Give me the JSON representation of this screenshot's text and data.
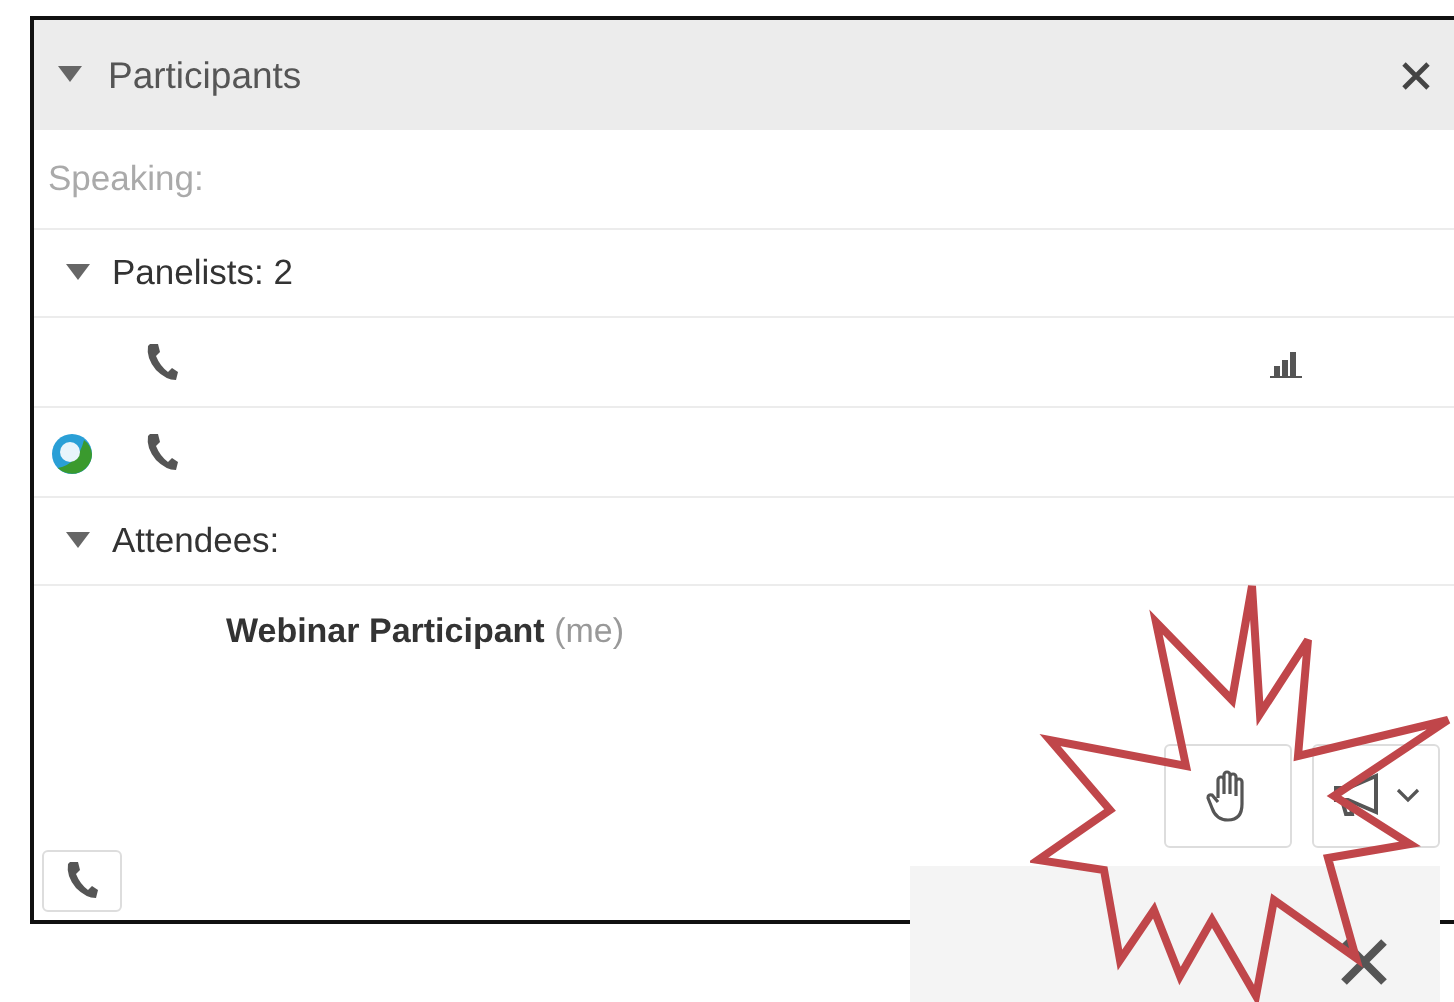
{
  "panel": {
    "title": "Participants",
    "expanded": true
  },
  "speaking": {
    "label": "Speaking:"
  },
  "groups": [
    {
      "label": "Panelists: 2",
      "expanded": true,
      "rows": [
        {
          "kind": "phone",
          "logo": false,
          "signal": true
        },
        {
          "kind": "phone",
          "logo": true,
          "signal": false
        }
      ]
    },
    {
      "label": "Attendees:",
      "expanded": true,
      "rows": [
        {
          "kind": "person",
          "name": "Webinar Participant",
          "suffix": "(me)"
        }
      ]
    }
  ]
}
